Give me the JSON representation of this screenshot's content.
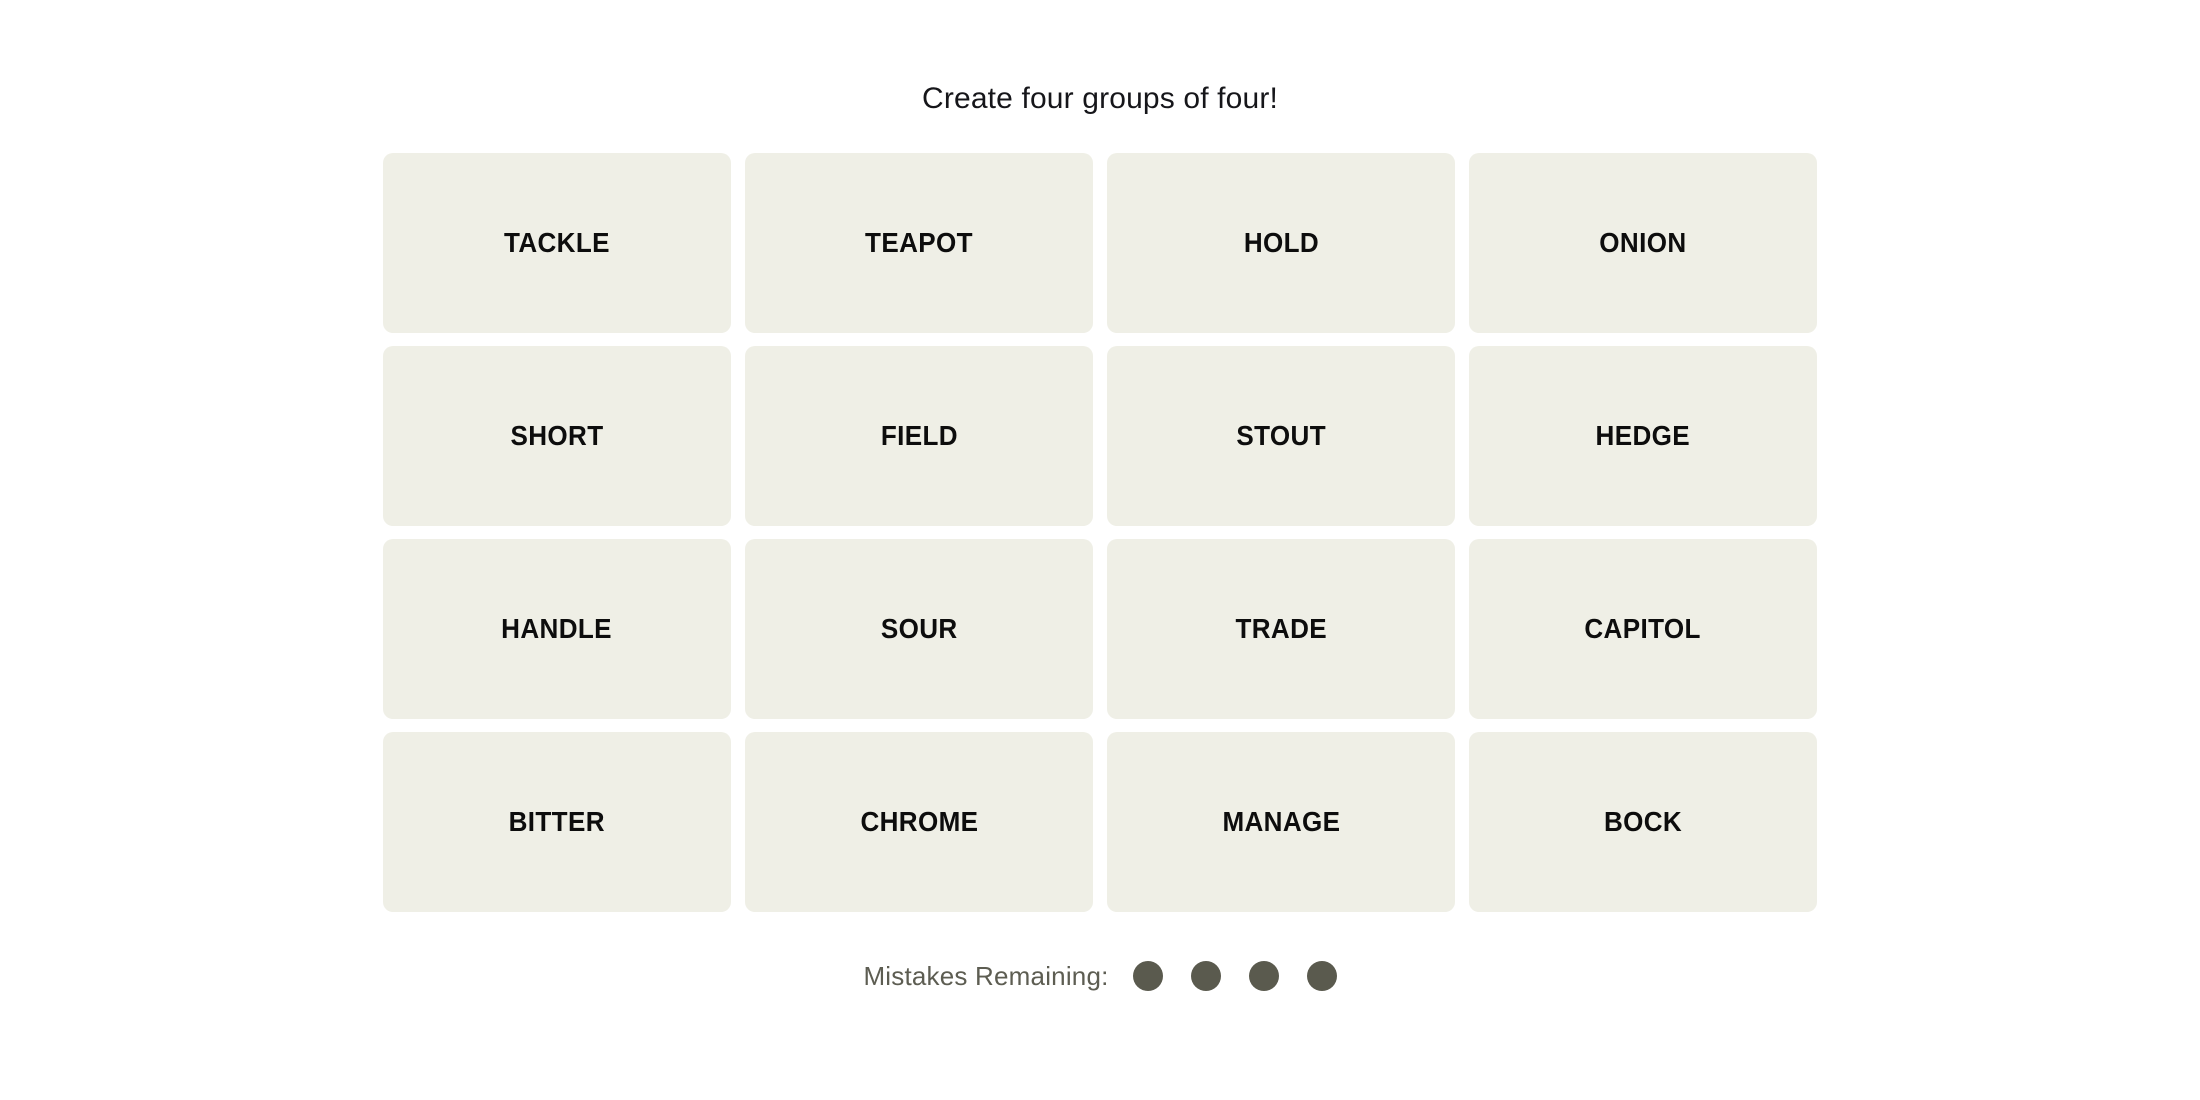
{
  "header": {
    "instruction": "Create four groups of four!"
  },
  "board": {
    "rows": 4,
    "columns": 4,
    "tiles": [
      {
        "label": "TACKLE",
        "row": 1,
        "column": 1,
        "selected": false
      },
      {
        "label": "TEAPOT",
        "row": 1,
        "column": 2,
        "selected": false
      },
      {
        "label": "HOLD",
        "row": 1,
        "column": 3,
        "selected": false
      },
      {
        "label": "ONION",
        "row": 1,
        "column": 4,
        "selected": false
      },
      {
        "label": "SHORT",
        "row": 2,
        "column": 1,
        "selected": false
      },
      {
        "label": "FIELD",
        "row": 2,
        "column": 2,
        "selected": false
      },
      {
        "label": "STOUT",
        "row": 2,
        "column": 3,
        "selected": false
      },
      {
        "label": "HEDGE",
        "row": 2,
        "column": 4,
        "selected": false
      },
      {
        "label": "HANDLE",
        "row": 3,
        "column": 1,
        "selected": false
      },
      {
        "label": "SOUR",
        "row": 3,
        "column": 2,
        "selected": false
      },
      {
        "label": "TRADE",
        "row": 3,
        "column": 3,
        "selected": false
      },
      {
        "label": "CAPITOL",
        "row": 3,
        "column": 4,
        "selected": false
      },
      {
        "label": "BITTER",
        "row": 4,
        "column": 1,
        "selected": false
      },
      {
        "label": "CHROME",
        "row": 4,
        "column": 2,
        "selected": false
      },
      {
        "label": "MANAGE",
        "row": 4,
        "column": 3,
        "selected": false
      },
      {
        "label": "BOCK",
        "row": 4,
        "column": 4,
        "selected": false
      }
    ]
  },
  "mistakes": {
    "label": "Mistakes Remaining:",
    "remaining": 4,
    "total": 4,
    "dots": [
      {
        "name": "mistake-dot-1",
        "filled": true
      },
      {
        "name": "mistake-dot-2",
        "filled": true
      },
      {
        "name": "mistake-dot-3",
        "filled": true
      },
      {
        "name": "mistake-dot-4",
        "filled": true
      }
    ]
  },
  "colors": {
    "page_background": "#FFFFFF",
    "tile_background": "#EFEFE6",
    "tile_text": "#0D0D0D",
    "title_text": "#16161A",
    "mistakes_label_text": "#5D5D52",
    "mistake_dot": "#5A5A4E"
  }
}
